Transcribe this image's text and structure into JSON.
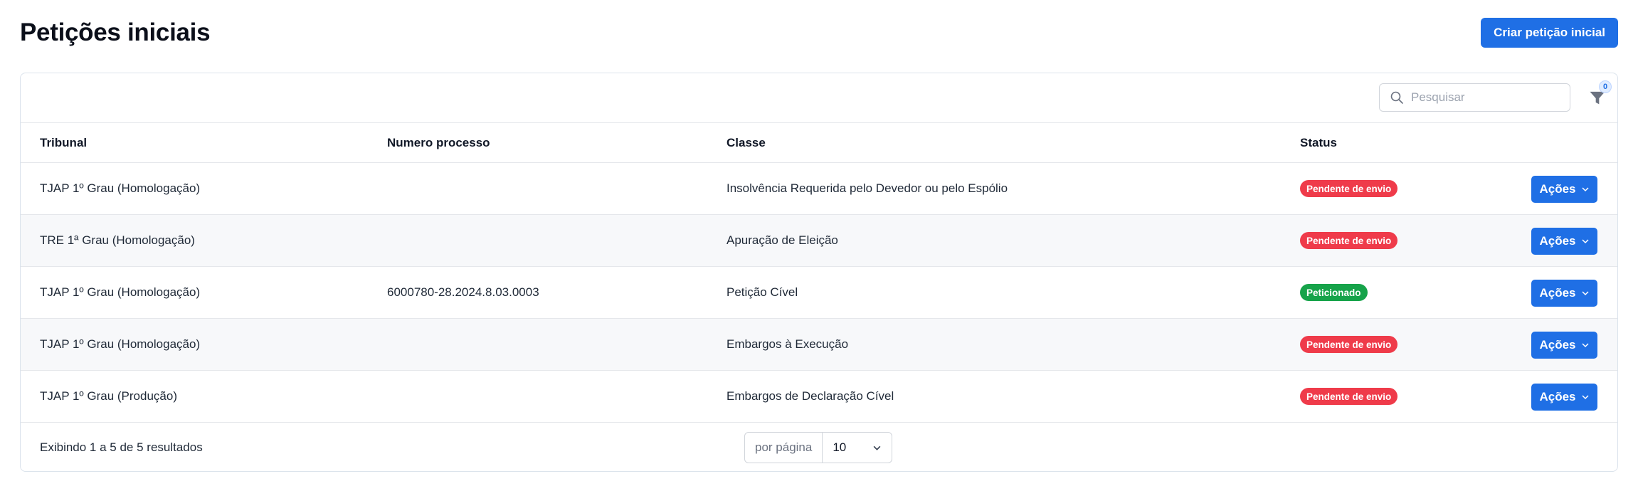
{
  "page": {
    "title": "Petições iniciais",
    "create_button": "Criar petição inicial"
  },
  "toolbar": {
    "search_placeholder": "Pesquisar",
    "filter_count": "0"
  },
  "table": {
    "headers": {
      "tribunal": "Tribunal",
      "numero": "Numero processo",
      "classe": "Classe",
      "status": "Status"
    },
    "action_label": "Ações",
    "rows": [
      {
        "tribunal": "TJAP 1º Grau (Homologação)",
        "numero": "",
        "classe": "Insolvência Requerida pelo Devedor ou pelo Espólio",
        "status": "Pendente de envio"
      },
      {
        "tribunal": "TRE 1ª Grau (Homologação)",
        "numero": "",
        "classe": "Apuração de Eleição",
        "status": "Pendente de envio"
      },
      {
        "tribunal": "TJAP 1º Grau (Homologação)",
        "numero": "6000780-28.2024.8.03.0003",
        "classe": "Petição Cível",
        "status": "Peticionado"
      },
      {
        "tribunal": "TJAP 1º Grau (Homologação)",
        "numero": "",
        "classe": "Embargos à Execução",
        "status": "Pendente de envio"
      },
      {
        "tribunal": "TJAP 1º Grau (Produção)",
        "numero": "",
        "classe": "Embargos de Declaração Cível",
        "status": "Pendente de envio"
      }
    ]
  },
  "footer": {
    "summary": "Exibindo 1 a 5 de 5 resultados",
    "per_page_label": "por página",
    "per_page_value": "10"
  },
  "colors": {
    "primary": "#1f6fe5",
    "status_pending": "#ef3b4a",
    "status_done": "#16a34a"
  }
}
